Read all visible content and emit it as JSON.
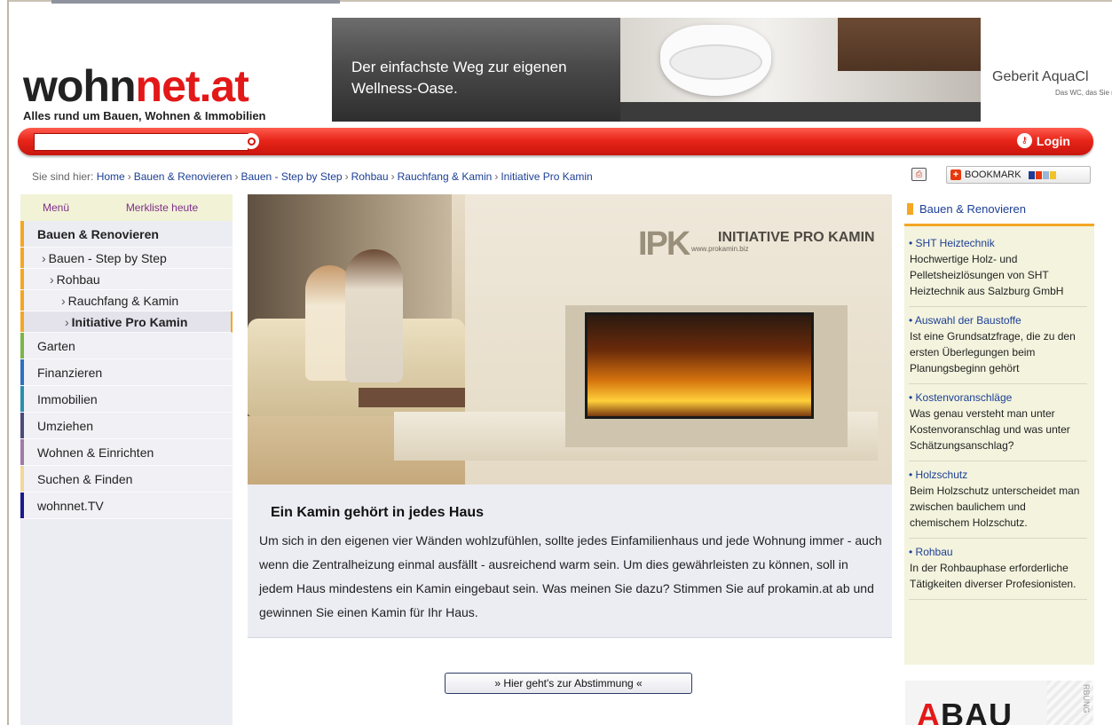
{
  "logo": {
    "part1": "wohn",
    "part2": "net.at",
    "tagline": "Alles rund um Bauen, Wohnen & Immobilien"
  },
  "banner": {
    "headline_line1": "Der einfachste Weg zur eigenen",
    "headline_line2": "Wellness-Oase.",
    "brand": "Geberit AquaCl",
    "brand_sub": "Das WC, das Sie mi"
  },
  "search": {
    "value": "",
    "placeholder": ""
  },
  "login_label": "Login",
  "breadcrumb": {
    "prefix": "Sie sind hier:",
    "items": [
      "Home",
      "Bauen & Renovieren",
      "Bauen - Step by Step",
      "Rohbau",
      "Rauchfang & Kamin",
      "Initiative Pro Kamin"
    ]
  },
  "bookmark_label": "BOOKMARK",
  "leftnav": {
    "tabs": [
      "Menü",
      "Merkliste heute"
    ],
    "active_section": "Bauen & Renovieren",
    "sub_items": [
      "Bauen - Step by Step",
      "Rohbau",
      "Rauchfang & Kamin",
      "Initiative Pro Kamin"
    ],
    "sections": [
      {
        "label": "Garten",
        "color": "#7ab648"
      },
      {
        "label": "Finanzieren",
        "color": "#2e6fc0"
      },
      {
        "label": "Immobilien",
        "color": "#2a8fb0"
      },
      {
        "label": "Umziehen",
        "color": "#4b4b78"
      },
      {
        "label": "Wohnen & Einrichten",
        "color": "#a07aa8"
      },
      {
        "label": "Suchen & Finden",
        "color": "#f2d79a"
      },
      {
        "label": "wohnnet.TV",
        "color": "#1a1a8c"
      }
    ],
    "accent_color": "#f5a623"
  },
  "hero": {
    "logo_letters": "IPK",
    "logo_text": "INITIATIVE PRO KAMIN",
    "logo_url": "www.prokamin.biz"
  },
  "article": {
    "title": "Ein Kamin gehört in jedes Haus",
    "body": "Um sich in den eigenen vier Wänden wohlzufühlen, sollte jedes Einfamilienhaus und jede Wohnung immer - auch wenn die Zentralheizung einmal ausfällt - ausreichend warm sein. Um dies gewährleisten zu können, soll in jedem Haus mindestens ein Kamin eingebaut sein. Was meinen Sie dazu? Stimmen Sie auf prokamin.at ab und gewinnen Sie einen Kamin für Ihr Haus."
  },
  "vote_button": "» Hier geht's zur Abstimmung «",
  "right": {
    "heading": "Bauen & Renovieren",
    "items": [
      {
        "title": "SHT Heiztechnik",
        "text": "Hochwertige Holz- und Pelletsheizlösungen von SHT Heiztechnik aus Salzburg GmbH"
      },
      {
        "title": "Auswahl der Baustoffe",
        "text": "Ist eine Grundsatzfrage, die zu den ersten Überlegungen beim Planungsbeginn gehört"
      },
      {
        "title": "Kostenvoranschläge",
        "text": "Was genau versteht man unter Kostenvoranschlag und was unter Schätzungsanschlag?"
      },
      {
        "title": "Holzschutz",
        "text": "Beim Holzschutz unterscheidet man zwischen baulichem und chemischem Holzschutz."
      },
      {
        "title": "Rohbau",
        "text": "In der Rohbauphase erforderliche Tätigkeiten diverser Profesionisten."
      }
    ]
  },
  "ad_bottom": {
    "letter_a": "A",
    "rest": "BAU",
    "vertical": "RBUNG"
  },
  "colors": {
    "brand_red": "#e31818",
    "link_blue": "#1c3f95",
    "accent_orange": "#f5a623"
  }
}
